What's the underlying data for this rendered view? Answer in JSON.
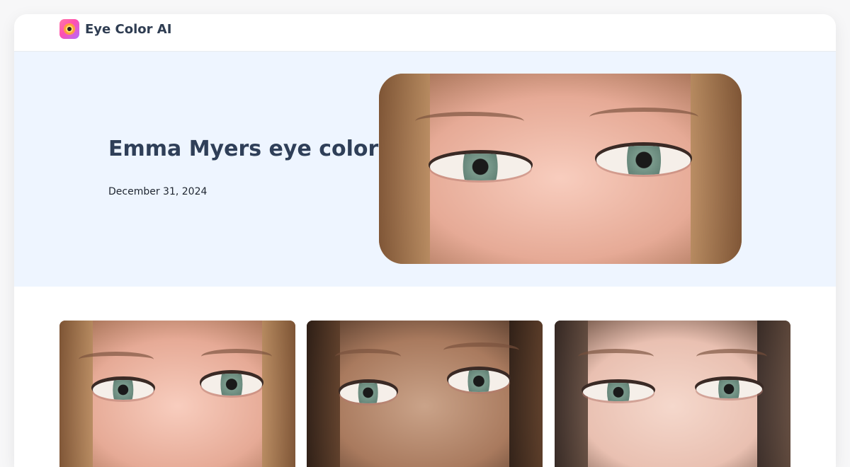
{
  "header": {
    "brand_name": "Eye Color AI",
    "logo_icon": "eye-logo-icon"
  },
  "hero": {
    "title": "Emma Myers eye color",
    "date": "December 31, 2024",
    "image_description": "Close-up of a woman's face showing green-grey eyes"
  },
  "gallery": {
    "items": [
      {
        "label": "eye-closeup-1"
      },
      {
        "label": "eye-closeup-2"
      },
      {
        "label": "eye-closeup-3"
      }
    ]
  },
  "colors": {
    "hero_background": "#eef5ff",
    "title_color": "#2f3f58",
    "eye_iris": "#6f8f82"
  }
}
